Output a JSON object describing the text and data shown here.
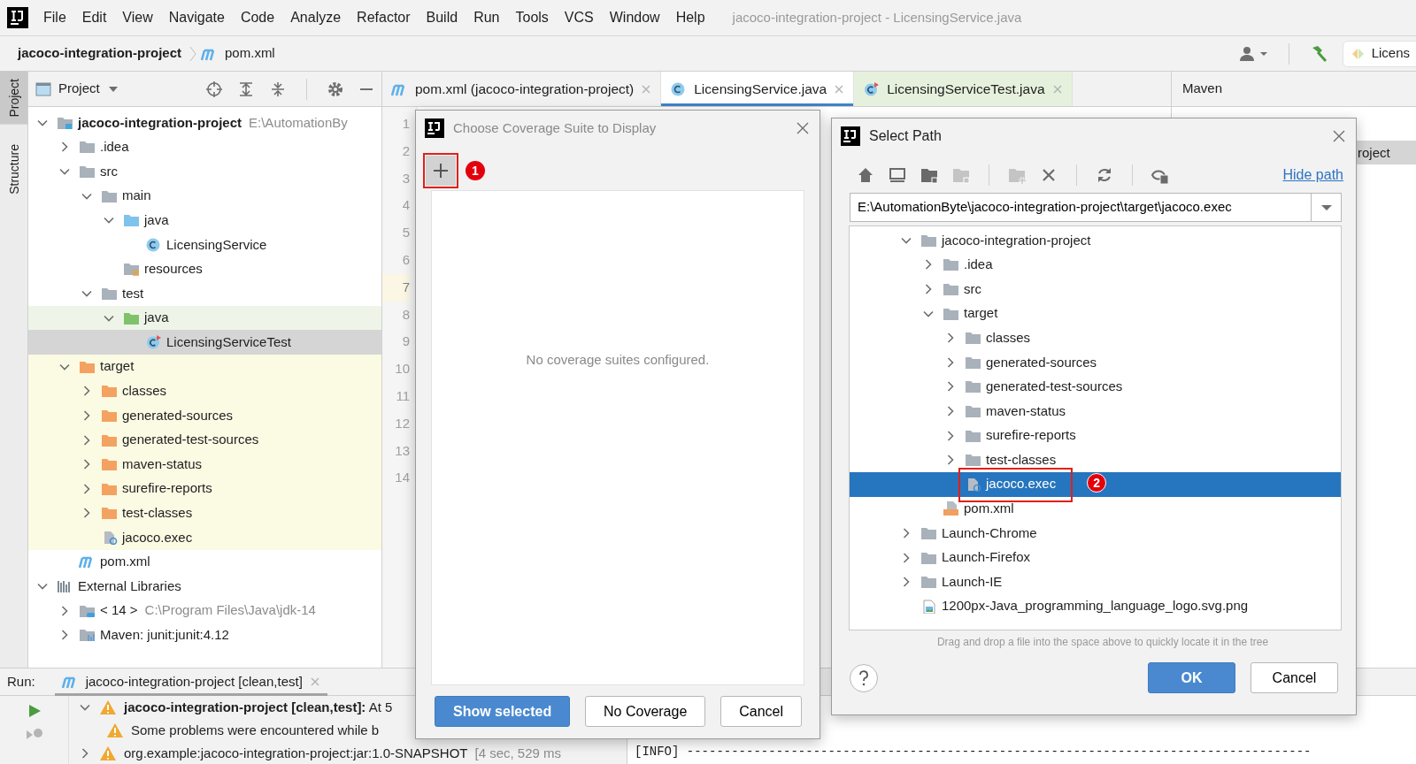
{
  "menu_bar": {
    "items": [
      "File",
      "Edit",
      "View",
      "Navigate",
      "Code",
      "Analyze",
      "Refactor",
      "Build",
      "Run",
      "Tools",
      "VCS",
      "Window",
      "Help"
    ],
    "title": "jacoco-integration-project - LicensingService.java"
  },
  "breadcrumb": [
    {
      "label": "jacoco-integration-project",
      "kind": "project"
    },
    {
      "label": "pom.xml",
      "kind": "maven"
    }
  ],
  "run_config": "Licens",
  "side_tabs": [
    {
      "label": "Project",
      "selected": true
    },
    {
      "label": "Structure",
      "selected": false
    }
  ],
  "project_panel": {
    "title": "Project",
    "tree": [
      {
        "label": "jacoco-integration-project",
        "hint": "E:\\AutomationBy",
        "kind": "module",
        "expanded": true,
        "selected": false,
        "children": [
          {
            "label": ".idea",
            "kind": "folder",
            "expanded": false,
            "selected": false
          },
          {
            "label": "src",
            "kind": "folder",
            "expanded": true,
            "selected": false,
            "children": [
              {
                "label": "main",
                "kind": "folder",
                "expanded": true,
                "selected": false,
                "children": [
                  {
                    "label": "java",
                    "kind": "source",
                    "expanded": true,
                    "selected": false,
                    "children": [
                      {
                        "label": "LicensingService",
                        "kind": "class",
                        "selected": false
                      }
                    ]
                  },
                  {
                    "label": "resources",
                    "kind": "resources",
                    "selected": false
                  }
                ]
              },
              {
                "label": "test",
                "kind": "folder",
                "expanded": true,
                "selected": false,
                "children": [
                  {
                    "label": "java",
                    "kind": "test-source",
                    "expanded": true,
                    "selected": false,
                    "test_root": true,
                    "children": [
                      {
                        "label": "LicensingServiceTest",
                        "kind": "test-class",
                        "selected": true
                      }
                    ]
                  }
                ]
              }
            ]
          },
          {
            "label": "target",
            "kind": "excluded",
            "expanded": true,
            "selected": false,
            "excluded": true,
            "children": [
              {
                "label": "classes",
                "kind": "excluded",
                "expanded": false,
                "selected": false,
                "excluded": true
              },
              {
                "label": "generated-sources",
                "kind": "excluded",
                "expanded": false,
                "selected": false,
                "excluded": true
              },
              {
                "label": "generated-test-sources",
                "kind": "excluded",
                "expanded": false,
                "selected": false,
                "excluded": true
              },
              {
                "label": "maven-status",
                "kind": "excluded",
                "expanded": false,
                "selected": false,
                "excluded": true
              },
              {
                "label": "surefire-reports",
                "kind": "excluded",
                "expanded": false,
                "selected": false,
                "excluded": true
              },
              {
                "label": "test-classes",
                "kind": "excluded",
                "expanded": false,
                "selected": false,
                "excluded": true
              },
              {
                "label": "jacoco.exec",
                "kind": "exec",
                "selected": false,
                "excluded": true
              }
            ]
          },
          {
            "label": "pom.xml",
            "kind": "maven",
            "selected": false
          }
        ]
      },
      {
        "label": "External Libraries",
        "kind": "libraries",
        "expanded": true,
        "selected": false,
        "children": [
          {
            "label": "< 14 >",
            "hint": "C:\\Program Files\\Java\\jdk-14",
            "kind": "jdk",
            "expanded": false,
            "selected": false
          },
          {
            "label": "Maven: junit:junit:4.12",
            "kind": "library",
            "expanded": false,
            "selected": false
          }
        ]
      }
    ]
  },
  "editor_tabs": [
    {
      "label": "pom.xml (jacoco-integration-project)",
      "kind": "maven",
      "selected": false
    },
    {
      "label": "LicensingService.java",
      "kind": "class",
      "selected": true
    },
    {
      "label": "LicensingServiceTest.java",
      "kind": "test-class",
      "selected": false,
      "test_root": true
    }
  ],
  "gutter": [
    {
      "number": "1",
      "current": false
    },
    {
      "number": "2",
      "current": false
    },
    {
      "number": "3",
      "current": false
    },
    {
      "number": "4",
      "current": false
    },
    {
      "number": "5",
      "current": false
    },
    {
      "number": "6",
      "current": false
    },
    {
      "number": "7",
      "current": true
    },
    {
      "number": "8",
      "current": false
    },
    {
      "number": "9",
      "current": false
    },
    {
      "number": "10",
      "current": false
    },
    {
      "number": "11",
      "current": false
    },
    {
      "number": "12",
      "current": false
    },
    {
      "number": "13",
      "current": false
    },
    {
      "number": "14",
      "current": false
    }
  ],
  "maven_panel": {
    "title": "Maven",
    "item": "roject"
  },
  "run_panel": {
    "label": "Run:",
    "tab": "jacoco-integration-project [clean,test]",
    "lines": [
      {
        "text": "**jacoco-integration-project [clean,test]:** At 5",
        "kind": "warning",
        "expanded": true
      },
      {
        "text": "Some problems were encountered while b",
        "kind": "warning"
      },
      {
        "text": "org.example:jacoco-integration-project:jar:1.0-SNAPSHOT",
        "hint": "[4 sec, 529 ms",
        "kind": "warning",
        "expanded": false
      }
    ],
    "console": "[INFO] ------------------------------------------------------------------------------------"
  },
  "coverage_dialog": {
    "title": "Choose Coverage Suite to Display",
    "add_callout": "1",
    "empty_text": "No coverage suites configured.",
    "buttons": [
      {
        "label": "Show selected",
        "primary": true
      },
      {
        "label": "No Coverage",
        "primary": false
      },
      {
        "label": "Cancel",
        "primary": false
      }
    ]
  },
  "select_path_dialog": {
    "title": "Select Path",
    "toolbar": [
      {
        "kind": "home",
        "disabled": false
      },
      {
        "kind": "desktop",
        "disabled": false
      },
      {
        "kind": "project-folder",
        "disabled": false
      },
      {
        "kind": "module-folder",
        "disabled": true
      },
      {
        "kind": "new-folder",
        "disabled": true
      },
      {
        "kind": "delete",
        "disabled": false
      },
      {
        "kind": "refresh",
        "disabled": false
      },
      {
        "kind": "hidden-files",
        "disabled": false
      }
    ],
    "hide_path": "Hide path",
    "path": "E:\\AutomationByte\\jacoco-integration-project\\target\\jacoco.exec",
    "tree": [
      {
        "label": "jacoco-integration-project",
        "kind": "folder",
        "expanded": true,
        "selected": false,
        "children": [
          {
            "label": ".idea",
            "kind": "folder",
            "expanded": false,
            "selected": false
          },
          {
            "label": "src",
            "kind": "folder",
            "expanded": false,
            "selected": false
          },
          {
            "label": "target",
            "kind": "folder",
            "expanded": true,
            "selected": false,
            "children": [
              {
                "label": "classes",
                "kind": "folder",
                "expanded": false,
                "selected": false
              },
              {
                "label": "generated-sources",
                "kind": "folder",
                "expanded": false,
                "selected": false
              },
              {
                "label": "generated-test-sources",
                "kind": "folder",
                "expanded": false,
                "selected": false
              },
              {
                "label": "maven-status",
                "kind": "folder",
                "expanded": false,
                "selected": false
              },
              {
                "label": "surefire-reports",
                "kind": "folder",
                "expanded": false,
                "selected": false
              },
              {
                "label": "test-classes",
                "kind": "folder",
                "expanded": false,
                "selected": false
              },
              {
                "label": "jacoco.exec",
                "kind": "exec",
                "selected": true,
                "callout": "2"
              }
            ]
          },
          {
            "label": "pom.xml",
            "kind": "xml",
            "selected": false
          }
        ]
      },
      {
        "label": "Launch-Chrome",
        "kind": "folder",
        "expanded": false,
        "selected": false
      },
      {
        "label": "Launch-Firefox",
        "kind": "folder",
        "expanded": false,
        "selected": false
      },
      {
        "label": "Launch-IE",
        "kind": "folder",
        "expanded": false,
        "selected": false
      },
      {
        "label": "1200px-Java_programming_language_logo.svg.png",
        "kind": "image",
        "selected": false
      }
    ],
    "hint": "Drag and drop a file into the space above to quickly locate it in the tree",
    "buttons": [
      {
        "label": "OK",
        "primary": true
      },
      {
        "label": "Cancel",
        "primary": false
      }
    ]
  }
}
